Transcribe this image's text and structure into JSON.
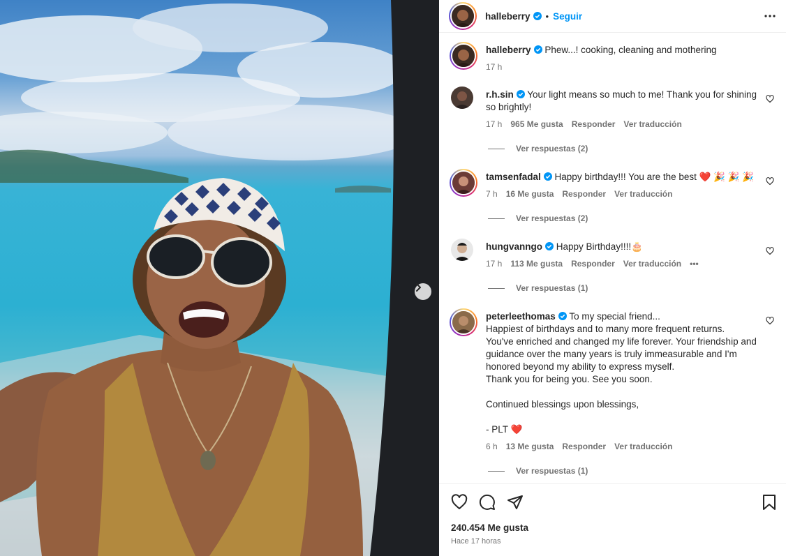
{
  "post": {
    "author": "halleberry",
    "follow_label": "Seguir",
    "caption": "Phew...! cooking, cleaning and mothering",
    "caption_time": "17 h",
    "likes": "240.454 Me gusta",
    "time_ago": "Hace 17 horas"
  },
  "comments": [
    {
      "user": "r.h.sin",
      "text": "Your light means so much to me! Thank you for shining so brightly!",
      "time": "17 h",
      "likes": "965 Me gusta",
      "reply": "Responder",
      "translate": "Ver traducción",
      "replies": "Ver respuestas (2)"
    },
    {
      "user": "tamsenfadal",
      "text": "Happy birthday!!! You are the best ❤️ 🎉 🎉 🎉",
      "time": "7 h",
      "likes": "16 Me gusta",
      "reply": "Responder",
      "translate": "Ver traducción",
      "replies": "Ver respuestas (2)"
    },
    {
      "user": "hungvanngo",
      "text": "Happy Birthday!!!!🎂",
      "time": "17 h",
      "likes": "113 Me gusta",
      "reply": "Responder",
      "translate": "Ver traducción",
      "more": "•••",
      "replies": "Ver respuestas (1)"
    },
    {
      "user": "peterleethomas",
      "text_lines": [
        "To my special friend...",
        "Happiest of birthdays and to many more frequent returns.",
        "You've enriched and changed my life forever. Your friendship and guidance over the many years is truly immeasurable and I'm honored beyond my ability to express myself.",
        "Thank you for being you. See you soon.",
        "",
        "Continued blessings upon blessings,",
        "",
        "- PLT ❤️"
      ],
      "time": "6 h",
      "likes": "13 Me gusta",
      "reply": "Responder",
      "translate": "Ver traducción",
      "replies": "Ver respuestas (1)"
    }
  ],
  "icons": {
    "like": "heart-icon",
    "comment": "comment-icon",
    "share": "send-icon",
    "save": "bookmark-icon",
    "more": "more-icon",
    "next": "chevron-right-icon",
    "verified": "verified-badge-icon"
  },
  "colors": {
    "accent": "#0095f6",
    "verified": "#0095f6",
    "muted": "#737373",
    "text": "#262626"
  }
}
